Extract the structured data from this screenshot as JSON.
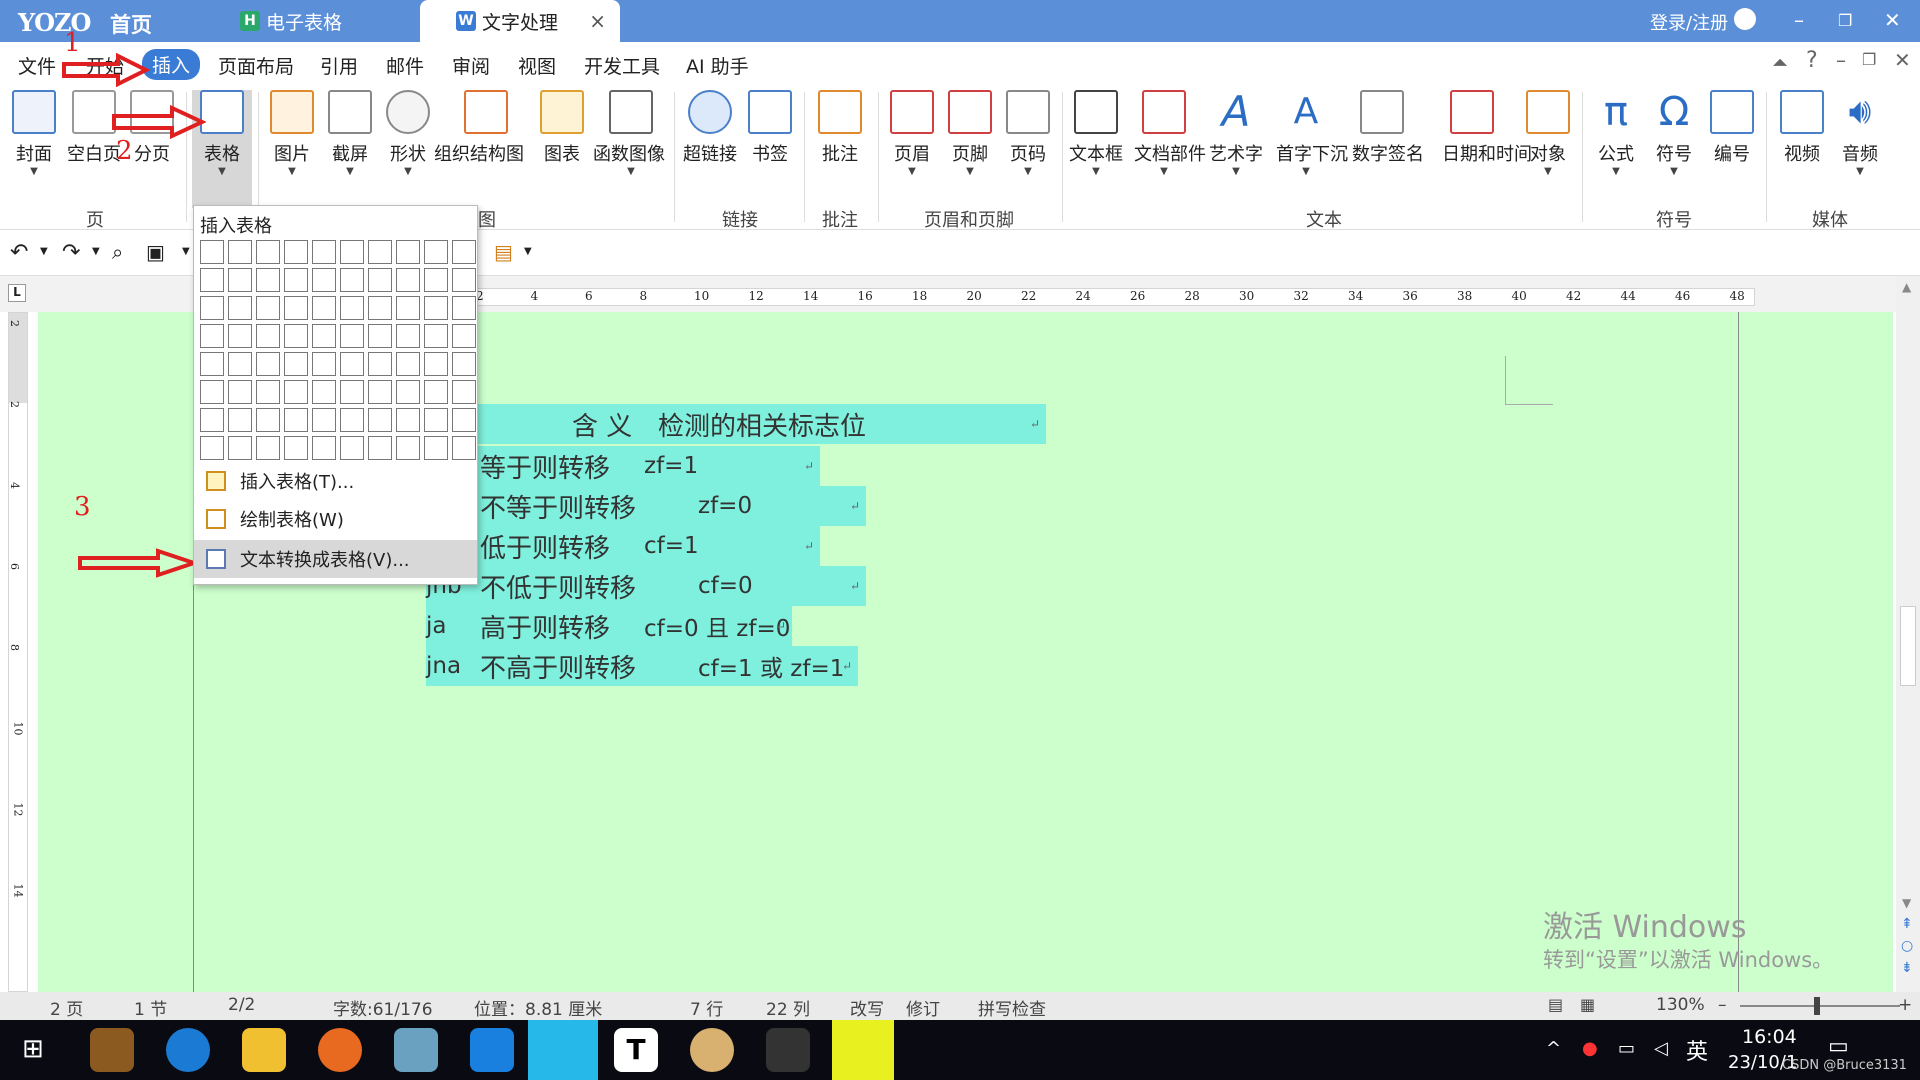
{
  "titlebar": {
    "logo": "YOZO",
    "home": "首页",
    "tab_sheet": "电子表格",
    "tab_doc": "文字处理",
    "tab_close": "×",
    "login": "登录/注册"
  },
  "menu": [
    "文件",
    "开始",
    "插入",
    "页面布局",
    "引用",
    "邮件",
    "审阅",
    "视图",
    "开发工具",
    "AI 助手"
  ],
  "ribbon": {
    "page": [
      "封面",
      "空白页",
      "分页"
    ],
    "table": "表格",
    "illus": [
      "图片",
      "截屏",
      "形状",
      "组织结构图",
      "图表",
      "函数图像"
    ],
    "links": [
      "超链接",
      "书签"
    ],
    "comment": "批注",
    "hf": [
      "页眉",
      "页脚",
      "页码"
    ],
    "text": [
      "文本框",
      "文档部件",
      "艺术字",
      "首字下沉",
      "数字签名",
      "日期和时间",
      "对象"
    ],
    "symbols": [
      "公式",
      "符号",
      "编号"
    ],
    "media": [
      "视频",
      "音频"
    ],
    "groups": {
      "page": "页",
      "partial": "图",
      "links": "链接",
      "comment": "批注",
      "hf": "页眉和页脚",
      "text": "文本",
      "symbols": "符号",
      "media": "媒体"
    }
  },
  "dropdown": {
    "title": "插入表格",
    "items": [
      "插入表格(T)...",
      "绘制表格(W)",
      "文本转换成表格(V)..."
    ]
  },
  "ruler": [
    "2",
    "4",
    "6",
    "8",
    "10",
    "12",
    "14",
    "16",
    "18",
    "20",
    "22",
    "24",
    "26",
    "28",
    "30",
    "32",
    "34",
    "36",
    "38",
    "40",
    "42",
    "44",
    "46",
    "48"
  ],
  "vruler": [
    "2",
    "2",
    "4",
    "6",
    "8",
    "10",
    "12",
    "14"
  ],
  "doc_rows": [
    {
      "a": "",
      "b": "含 义",
      "c": "检测的相关标志位"
    },
    {
      "a": "",
      "b": "等于则转移",
      "c": "zf=1"
    },
    {
      "a": "",
      "b": "不等于则转移",
      "c": "zf=0"
    },
    {
      "a": "",
      "b": "低于则转移",
      "c": "cf=1"
    },
    {
      "a": "jnb",
      "b": "不低于则转移",
      "c": "cf=0"
    },
    {
      "a": "ja",
      "b": "高于则转移",
      "c": "cf=0 且 zf=0"
    },
    {
      "a": "jna",
      "b": "不高于则转移",
      "c": "cf=1 或 zf=1"
    }
  ],
  "annotations": [
    "1",
    "2",
    "3"
  ],
  "watermark": {
    "line1": "激活 Windows",
    "line2": "转到“设置”以激活 Windows。"
  },
  "status": {
    "pages": "2 页",
    "section": "1 节",
    "pos_page": "2/2",
    "words": "字数:61/176",
    "position": "位置：8.81 厘米",
    "line": "7 行",
    "col": "22 列",
    "overwrite": "改写",
    "revise": "修订",
    "spell": "拼写检查",
    "zoom": "130%"
  },
  "taskbar": {
    "time": "16:04",
    "date": "23/10/1",
    "lang": "英",
    "credit": "CSDN @Bruce3131"
  },
  "colors": {
    "titlebar": "#5b8fd8",
    "accent": "#3a7bd5",
    "doc_bg": "#ccffcc",
    "highlight": "#7ff0dd",
    "annot": "#e02020"
  }
}
